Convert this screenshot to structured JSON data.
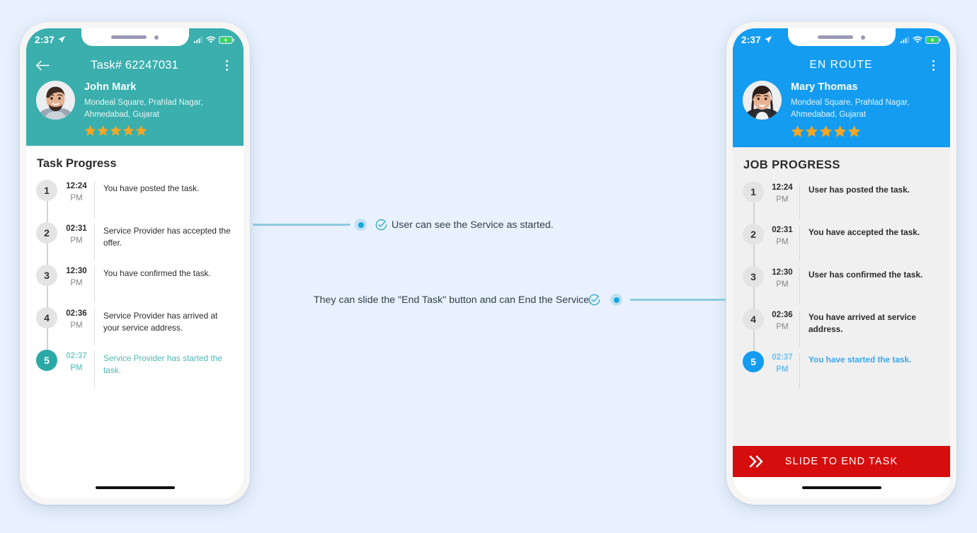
{
  "page": {
    "background_color": "#e8f1fd"
  },
  "phones": [
    {
      "id": "customer-app",
      "accent_color": "#3aafad",
      "statusbar": {
        "time": "2:37",
        "location_icon": "location-arrow-icon",
        "signal_icon": "signal-bars-icon",
        "wifi_icon": "wifi-icon",
        "battery_icon": "battery-charging-icon",
        "battery_color": "#3ad656"
      },
      "appbar": {
        "back_icon": "back-arrow-icon",
        "title": "Task# 62247031",
        "menu_icon": "kebab-menu-icon"
      },
      "profile": {
        "avatar_alt": "John Mark avatar",
        "name": "John Mark",
        "address_line1": "Mondeal Square, Prahlad Nagar,",
        "address_line2": "Ahmedabad, Gujarat",
        "rating": 5,
        "star_color": "#f5a623"
      },
      "section_title": "Task Progress",
      "timeline": [
        {
          "step": "1",
          "time": "12:24",
          "meridiem": "PM",
          "text": "You have posted the task.",
          "active": false
        },
        {
          "step": "2",
          "time": "02:31",
          "meridiem": "PM",
          "text": "Service Provider has accepted the offer.",
          "active": false
        },
        {
          "step": "3",
          "time": "12:30",
          "meridiem": "PM",
          "text": "You have confirmed the task.",
          "active": false
        },
        {
          "step": "4",
          "time": "02:36",
          "meridiem": "PM",
          "text": "Service Provider has arrived at your service address.",
          "active": false
        },
        {
          "step": "5",
          "time": "02:37",
          "meridiem": "PM",
          "text": "Service Provider has started the task.",
          "active": true
        }
      ],
      "action_button": null
    },
    {
      "id": "provider-app",
      "accent_color": "#139cf0",
      "statusbar": {
        "time": "2:37",
        "location_icon": "location-arrow-icon",
        "signal_icon": "signal-bars-icon",
        "wifi_icon": "wifi-icon",
        "battery_icon": "battery-charging-icon",
        "battery_color": "#3ad656"
      },
      "appbar": {
        "back_icon": null,
        "title": "EN ROUTE",
        "menu_icon": "kebab-menu-icon"
      },
      "profile": {
        "avatar_alt": "Mary Thomas avatar",
        "name": "Mary Thomas",
        "address_line1": "Mondeal Square, Prahlad Nagar,",
        "address_line2": "Ahmedabad, Gujarat",
        "rating": 5,
        "star_color": "#f5a623"
      },
      "section_title": "JOB PROGRESS",
      "timeline": [
        {
          "step": "1",
          "time": "12:24",
          "meridiem": "PM",
          "text": "User has posted the task.",
          "active": false
        },
        {
          "step": "2",
          "time": "02:31",
          "meridiem": "PM",
          "text": "You have accepted the task.",
          "active": false
        },
        {
          "step": "3",
          "time": "12:30",
          "meridiem": "PM",
          "text": "User has confirmed the task.",
          "active": false
        },
        {
          "step": "4",
          "time": "02:36",
          "meridiem": "PM",
          "text": "You have arrived at service address.",
          "active": false
        },
        {
          "step": "5",
          "time": "02:37",
          "meridiem": "PM",
          "text": "You have started the task.",
          "active": true
        }
      ],
      "action_button": {
        "label": "SLIDE TO END TASK",
        "color": "#d60d0d",
        "handle_icon": "double-chevron-right-icon"
      }
    }
  ],
  "annotations": [
    {
      "id": "left-callout",
      "text": "User can see the Service as started.",
      "check_icon": "check-circle-icon",
      "dot_color": "#16a7d8",
      "line_color": "#8cc9df"
    },
    {
      "id": "right-callout",
      "text": "They can slide the \"End Task\" button and can End the Service.",
      "check_icon": "check-circle-icon",
      "dot_color": "#16a7d8",
      "line_color": "#8cc9df"
    }
  ]
}
